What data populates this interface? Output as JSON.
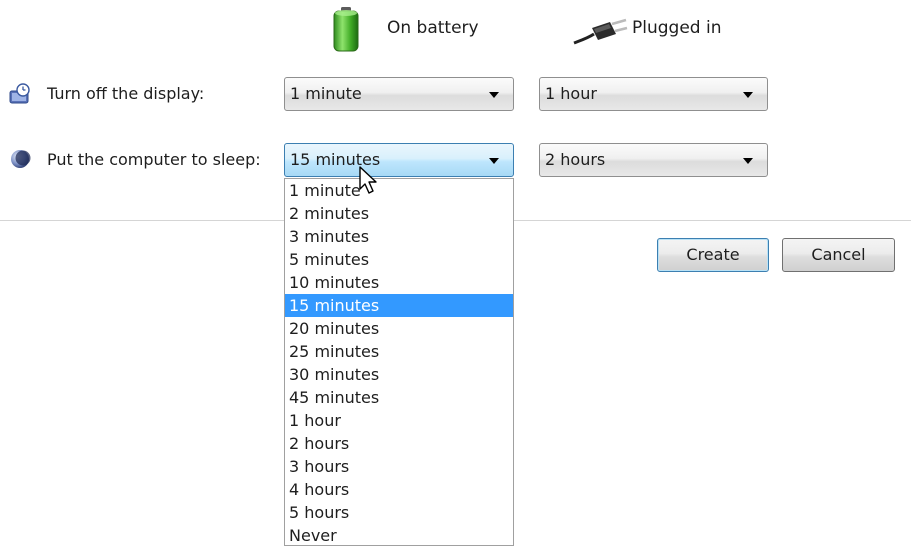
{
  "header": {
    "on_battery": "On battery",
    "plugged_in": "Plugged in"
  },
  "settings": {
    "display_label": "Turn off the display:",
    "display_battery": "1 minute",
    "display_plugged": "1 hour",
    "sleep_label": "Put the computer to sleep:",
    "sleep_battery": "15 minutes",
    "sleep_plugged": "2 hours"
  },
  "dropdown": {
    "options": [
      "1 minute",
      "2 minutes",
      "3 minutes",
      "5 minutes",
      "10 minutes",
      "15 minutes",
      "20 minutes",
      "25 minutes",
      "30 minutes",
      "45 minutes",
      "1 hour",
      "2 hours",
      "3 hours",
      "4 hours",
      "5 hours",
      "Never"
    ],
    "selected_index": 5
  },
  "buttons": {
    "create": "Create",
    "cancel": "Cancel"
  },
  "icons": {
    "battery": "battery-icon",
    "plug": "plug-icon",
    "display": "display-clock-icon",
    "sleep": "moon-icon"
  }
}
